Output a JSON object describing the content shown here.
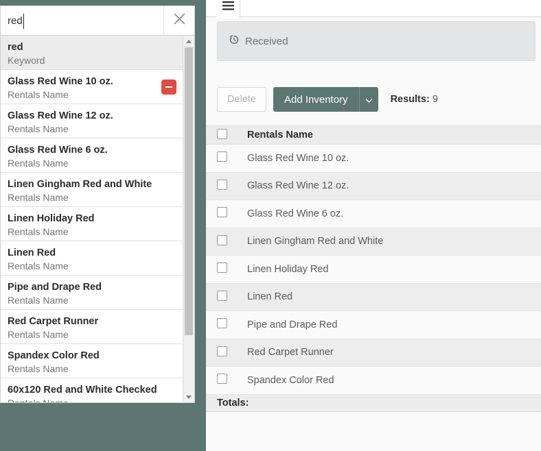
{
  "colors": {
    "brand_teal": "#5c7672",
    "danger_red": "#e04c42",
    "panel_bg": "#fafafa",
    "header_row": "#ececec"
  },
  "app": {
    "menu_icon": "hamburger-icon",
    "tabs": [
      {
        "label": "Received",
        "icon": "history-clock-icon"
      }
    ]
  },
  "toolbar": {
    "delete_label": "Delete",
    "add_inventory_label": "Add Inventory",
    "dropdown_caret_icon": "chevron-down-icon",
    "results_label": "Results",
    "results_separator": ":",
    "results_count": "9"
  },
  "table": {
    "columns": [
      "Rentals Name"
    ],
    "rows": [
      {
        "name": "Glass Red Wine 10 oz."
      },
      {
        "name": "Glass Red Wine 12 oz."
      },
      {
        "name": "Glass Red Wine 6 oz."
      },
      {
        "name": "Linen Gingham Red and White"
      },
      {
        "name": "Linen Holiday Red"
      },
      {
        "name": "Linen Red"
      },
      {
        "name": "Pipe and Drape Red"
      },
      {
        "name": "Red Carpet Runner"
      },
      {
        "name": "Spandex Color Red"
      }
    ],
    "totals_label": "Totals:"
  },
  "search": {
    "value": "red",
    "placeholder": "",
    "clear_icon": "close-x-icon",
    "suggestions": [
      {
        "title": "red",
        "subtitle": "Keyword",
        "highlighted": true,
        "badge": false
      },
      {
        "title": "Glass Red Wine 10 oz.",
        "subtitle": "Rentals Name",
        "highlighted": false,
        "badge": true
      },
      {
        "title": "Glass Red Wine 12 oz.",
        "subtitle": "Rentals Name",
        "highlighted": false,
        "badge": false
      },
      {
        "title": "Glass Red Wine 6 oz.",
        "subtitle": "Rentals Name",
        "highlighted": false,
        "badge": false
      },
      {
        "title": "Linen Gingham Red and White",
        "subtitle": "Rentals Name",
        "highlighted": false,
        "badge": false
      },
      {
        "title": "Linen Holiday Red",
        "subtitle": "Rentals Name",
        "highlighted": false,
        "badge": false
      },
      {
        "title": "Linen Red",
        "subtitle": "Rentals Name",
        "highlighted": false,
        "badge": false
      },
      {
        "title": "Pipe and Drape Red",
        "subtitle": "Rentals Name",
        "highlighted": false,
        "badge": false
      },
      {
        "title": "Red Carpet Runner",
        "subtitle": "Rentals Name",
        "highlighted": false,
        "badge": false
      },
      {
        "title": "Spandex Color Red",
        "subtitle": "Rentals Name",
        "highlighted": false,
        "badge": false
      },
      {
        "title": "60x120 Red and White Checked",
        "subtitle": "Rentals Name",
        "highlighted": false,
        "badge": false
      }
    ],
    "scrollbar": {
      "up_icon": "triangle-up-icon",
      "down_icon": "triangle-down-icon"
    }
  }
}
